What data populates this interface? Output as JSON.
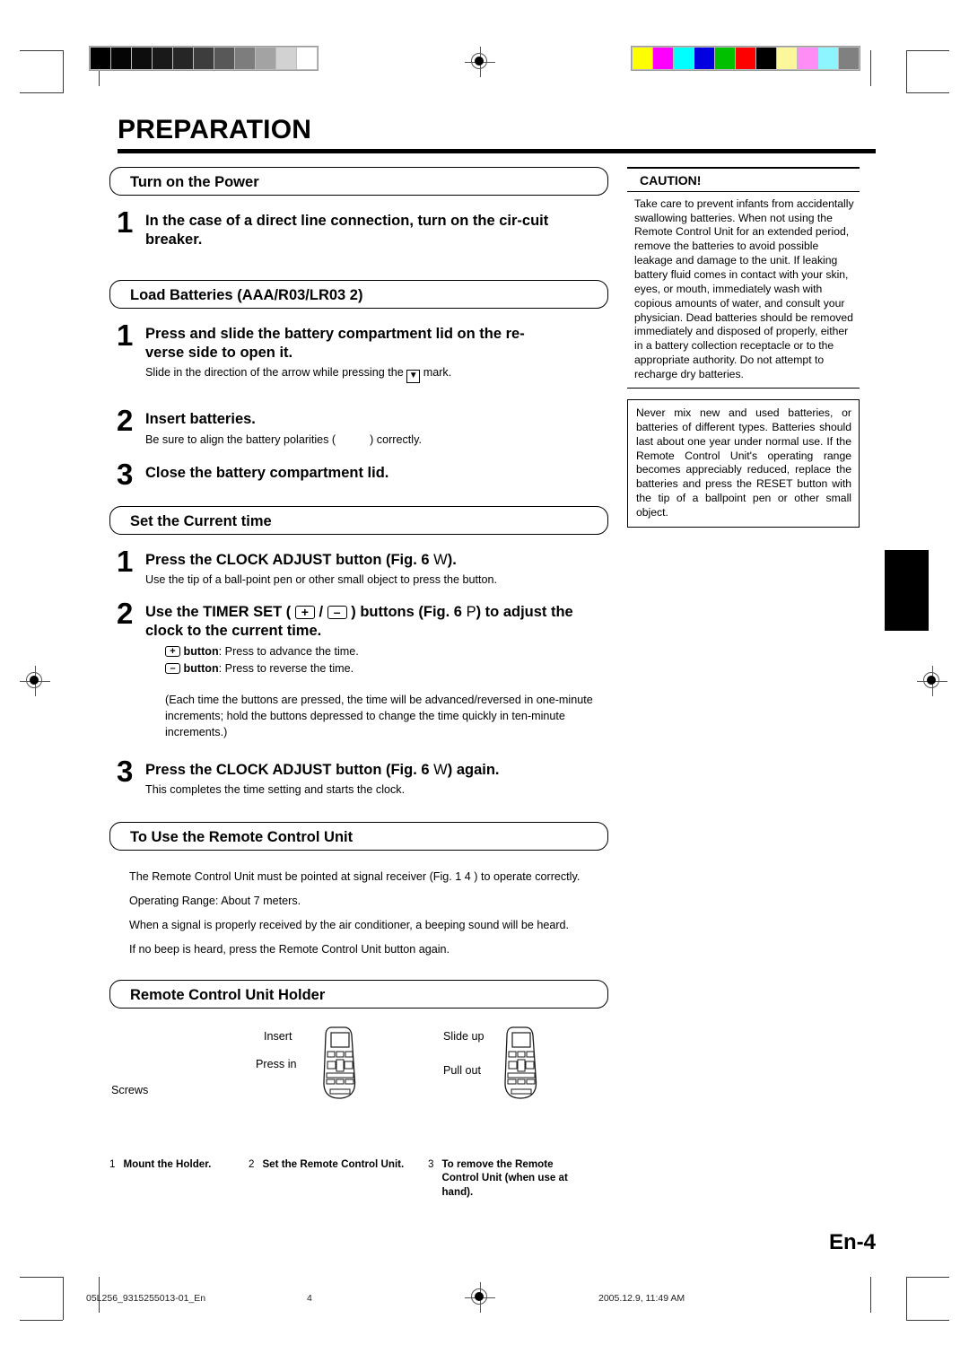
{
  "page": {
    "title": "PREPARATION",
    "page_label": "En-4"
  },
  "footer": {
    "file_id": "05L256_9315255013-01_En",
    "page_number": "4",
    "timestamp": "2005.12.9, 11:49 AM"
  },
  "print_marks": {
    "gray_wedge": [
      "#000000",
      "#050505",
      "#0d0d0d",
      "#191919",
      "#262626",
      "#3d3d3d",
      "#585858",
      "#7d7d7d",
      "#a3a3a3",
      "#d2d2d2",
      "#ffffff"
    ],
    "color_bar": [
      "#ffff00",
      "#ff00ff",
      "#00ffff",
      "#0000e0",
      "#00c000",
      "#ff0000",
      "#000000",
      "#fbf79a",
      "#ff8df5",
      "#8df5ff",
      "#808080"
    ]
  },
  "sections": {
    "turn_on_power": {
      "heading": "Turn on the Power",
      "steps": [
        {
          "num": "1",
          "head": "In the case of a direct line connection, turn on the cir-cuit breaker.",
          "sub": ""
        }
      ]
    },
    "load_batteries": {
      "heading": "Load Batteries (AAA/R03/LR03    2)",
      "steps": [
        {
          "num": "1",
          "head_a": "Press and slide the battery compartment lid on the re-",
          "head_b": "verse side to open it.",
          "sub_a": "Slide in the direction of the arrow while pressing the ",
          "sub_b": " mark.",
          "mark_glyph": "▼"
        },
        {
          "num": "2",
          "head": "Insert batteries.",
          "sub_a": "Be sure to align the battery polarities (",
          "sub_b": ") correctly."
        },
        {
          "num": "3",
          "head": "Close the battery compartment lid.",
          "sub": ""
        }
      ]
    },
    "set_current_time": {
      "heading": "Set the Current time",
      "steps": [
        {
          "num": "1",
          "head_a": "Press the CLOCK ADJUST button (Fig. 6 ",
          "head_fig": "W",
          "head_b": ").",
          "sub": "Use the tip of a ball-point pen or other small object to press the button."
        },
        {
          "num": "2",
          "head_a": "Use the TIMER SET (",
          "key_plus": "+",
          "head_mid": "/",
          "key_minus": "–",
          "head_b": ") buttons (Fig. 6 ",
          "head_fig": "P",
          "head_c": ") to adjust the clock to the current time.",
          "bullets": [
            {
              "key": "+",
              "label": "button",
              "text": ": Press to advance the time."
            },
            {
              "key": "–",
              "label": "button",
              "text": ": Press to reverse the time."
            }
          ],
          "note": "(Each time the buttons are pressed, the time will be advanced/reversed in one-minute increments; hold the buttons depressed to change the time quickly in ten-minute increments.)"
        },
        {
          "num": "3",
          "head_a": "Press the CLOCK ADJUST button  (Fig. 6 ",
          "head_fig": "W",
          "head_b": ") again.",
          "sub": "This completes the time setting and starts the clock."
        }
      ]
    },
    "to_use_remote": {
      "heading": "To Use the Remote Control Unit",
      "paragraphs": [
        "The Remote Control Unit must be pointed at signal receiver (Fig. 1 4  ) to operate correctly.",
        "Operating Range: About 7 meters.",
        "When a signal is properly received by the air conditioner, a beeping sound will be heard.",
        "If no beep is heard, press the Remote Control Unit button again."
      ]
    },
    "holder": {
      "heading": "Remote Control Unit Holder",
      "labels": {
        "screws": "Screws",
        "insert": "Insert",
        "press_in": "Press in",
        "slide_up": "Slide up",
        "pull_out": "Pull out"
      },
      "captions": [
        {
          "num": "1",
          "text": "Mount the Holder."
        },
        {
          "num": "2",
          "text": "Set the Remote Control Unit."
        },
        {
          "num": "3",
          "text": "To remove the Remote Control Unit (when use at hand)."
        }
      ]
    }
  },
  "caution": {
    "title": "CAUTION!",
    "body": "Take care to prevent infants from accidentally swallowing batteries. When not using the Remote Control Unit for an extended period, remove the batteries to avoid possible leakage and damage to the unit. If leaking battery fluid comes in contact with your skin, eyes, or mouth, immediately wash with copious amounts of water, and consult your physician. Dead batteries should be removed immediately and disposed of properly, either in a battery collection receptacle or to the appropriate authority. Do not attempt to recharge dry batteries.",
    "note_box": "Never mix new and used batteries, or batteries of different types. Batteries should last about one year under normal use. If the Remote Control Unit's operating range becomes appreciably reduced, replace the batteries and press the RESET button with the tip of a ballpoint pen or other small object."
  }
}
